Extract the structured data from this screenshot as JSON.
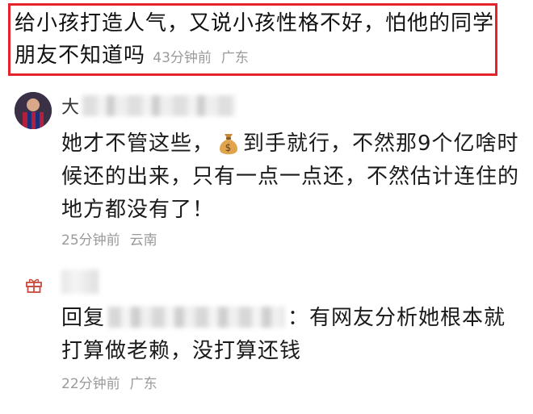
{
  "top_comment": {
    "text": "给小孩打造人气，又说小孩性格不好，怕他的同学朋友不知道吗",
    "time": "43分钟前",
    "location": "广东"
  },
  "comment": {
    "author_visible": "大",
    "text_before_icon": "她才不管这些，",
    "icon": "money-bag-emoji",
    "text_after_icon": "到手就行，不然那9个亿啥时候还的出来，只有一点一点还，不然估计连住的地方都没有了！",
    "time": "25分钟前",
    "location": "云南"
  },
  "reply": {
    "icon": "gift-icon",
    "prefix": "回复",
    "text": "：有网友分析她根本就打算做老赖，没打算还钱",
    "time": "22分钟前",
    "location": "广东"
  },
  "colors": {
    "highlight_border": "#e4242c",
    "meta_text": "#9a9a9a"
  }
}
